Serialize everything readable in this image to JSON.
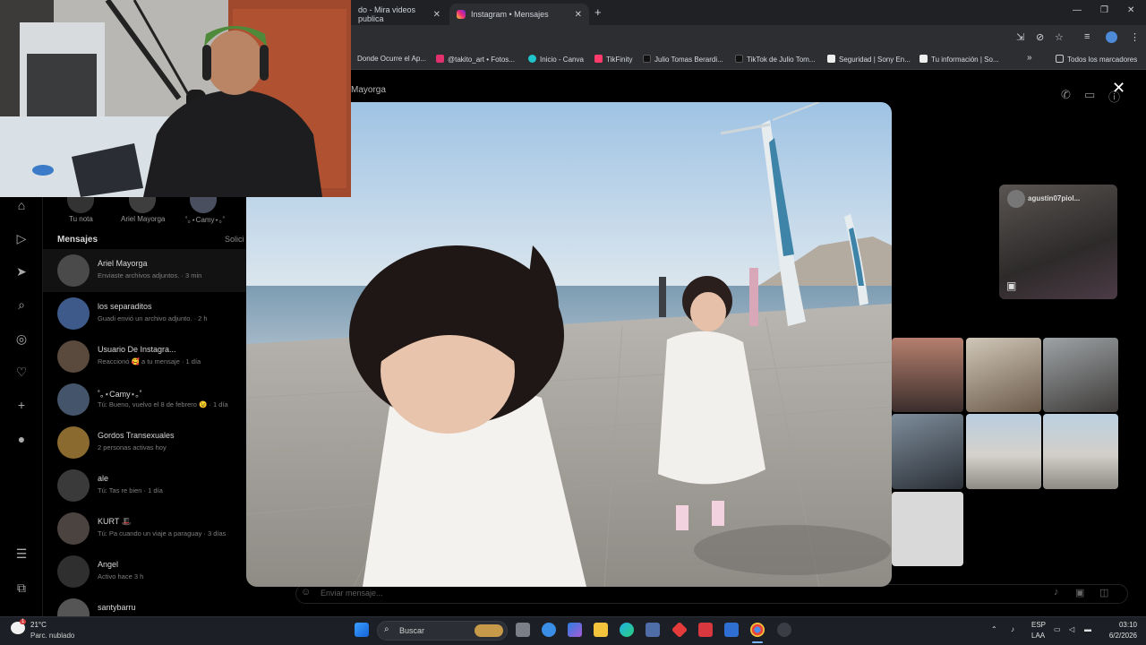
{
  "browser": {
    "tabs": [
      {
        "label": "do - Mira videos publica",
        "close": "✕"
      },
      {
        "label": "Instagram • Mensajes",
        "close": "✕"
      }
    ],
    "new_tab": "+",
    "window_controls": {
      "minimize": "—",
      "restore": "❐",
      "close": "✕"
    },
    "bookmarks": [
      {
        "label": "Donde Ocurre el Ap..."
      },
      {
        "label": "@takito_art • Fotos..."
      },
      {
        "label": "Inicio - Canva"
      },
      {
        "label": "TikFinity"
      },
      {
        "label": "Julio Tomas Berardi..."
      },
      {
        "label": "TikTok de Julio Tom..."
      },
      {
        "label": "Seguridad | Sony En..."
      },
      {
        "label": "Tu información | So..."
      }
    ],
    "more_bookmarks": "»",
    "all_bookmarks": "Todos los marcadores"
  },
  "instagram": {
    "notes": [
      {
        "label": "Tu nota"
      },
      {
        "label": "Ariel Mayorga"
      },
      {
        "label": "˚｡⋆Camy⋆｡˚"
      }
    ],
    "messages_title": "Mensajes",
    "requests_label": "Solici",
    "conversations": [
      {
        "name": "Ariel Mayorga",
        "sub": "Enviaste archivos adjuntos. · 3 min"
      },
      {
        "name": "los separaditos",
        "sub": "Guadi envió un archivo adjunto. · 2 h"
      },
      {
        "name": "Usuario De Instagra...",
        "sub": "Reaccionó 🥰 a tu mensaje · 1 día"
      },
      {
        "name": "˚｡⋆Camy⋆｡˚",
        "sub": "Tú: Bueno, vuelvo el 8 de febrero 😉 · 1 día"
      },
      {
        "name": "Gordos Transexuales",
        "sub": "2 personas activas hoy"
      },
      {
        "name": "ale",
        "sub": "Tú: Tas re bien · 1 día"
      },
      {
        "name": "KURT 🎩",
        "sub": "Tú: Pa cuando un viaje a paraguay · 3 días"
      },
      {
        "name": "Angel",
        "sub": "Activo hace 3 h"
      },
      {
        "name": "santybarru",
        "sub": ""
      }
    ],
    "chat": {
      "name": "Mayorga",
      "composer_placeholder": "Enviar mensaje...",
      "reel_user": "agustin07piol..."
    },
    "close_viewer": "✕"
  },
  "taskbar": {
    "temperature": "21°C",
    "weather": "Parc. nublado",
    "search_placeholder": "Buscar",
    "language": "ESP",
    "layout": "LAA",
    "time": "03:10",
    "date": "6/2/2026",
    "weather_badge": "1"
  },
  "colors": {
    "ig_bg": "#000000",
    "chrome_bg": "#2c2e32",
    "taskbar_bg": "#1c1f26",
    "accent_blue": "#0a84ff"
  }
}
